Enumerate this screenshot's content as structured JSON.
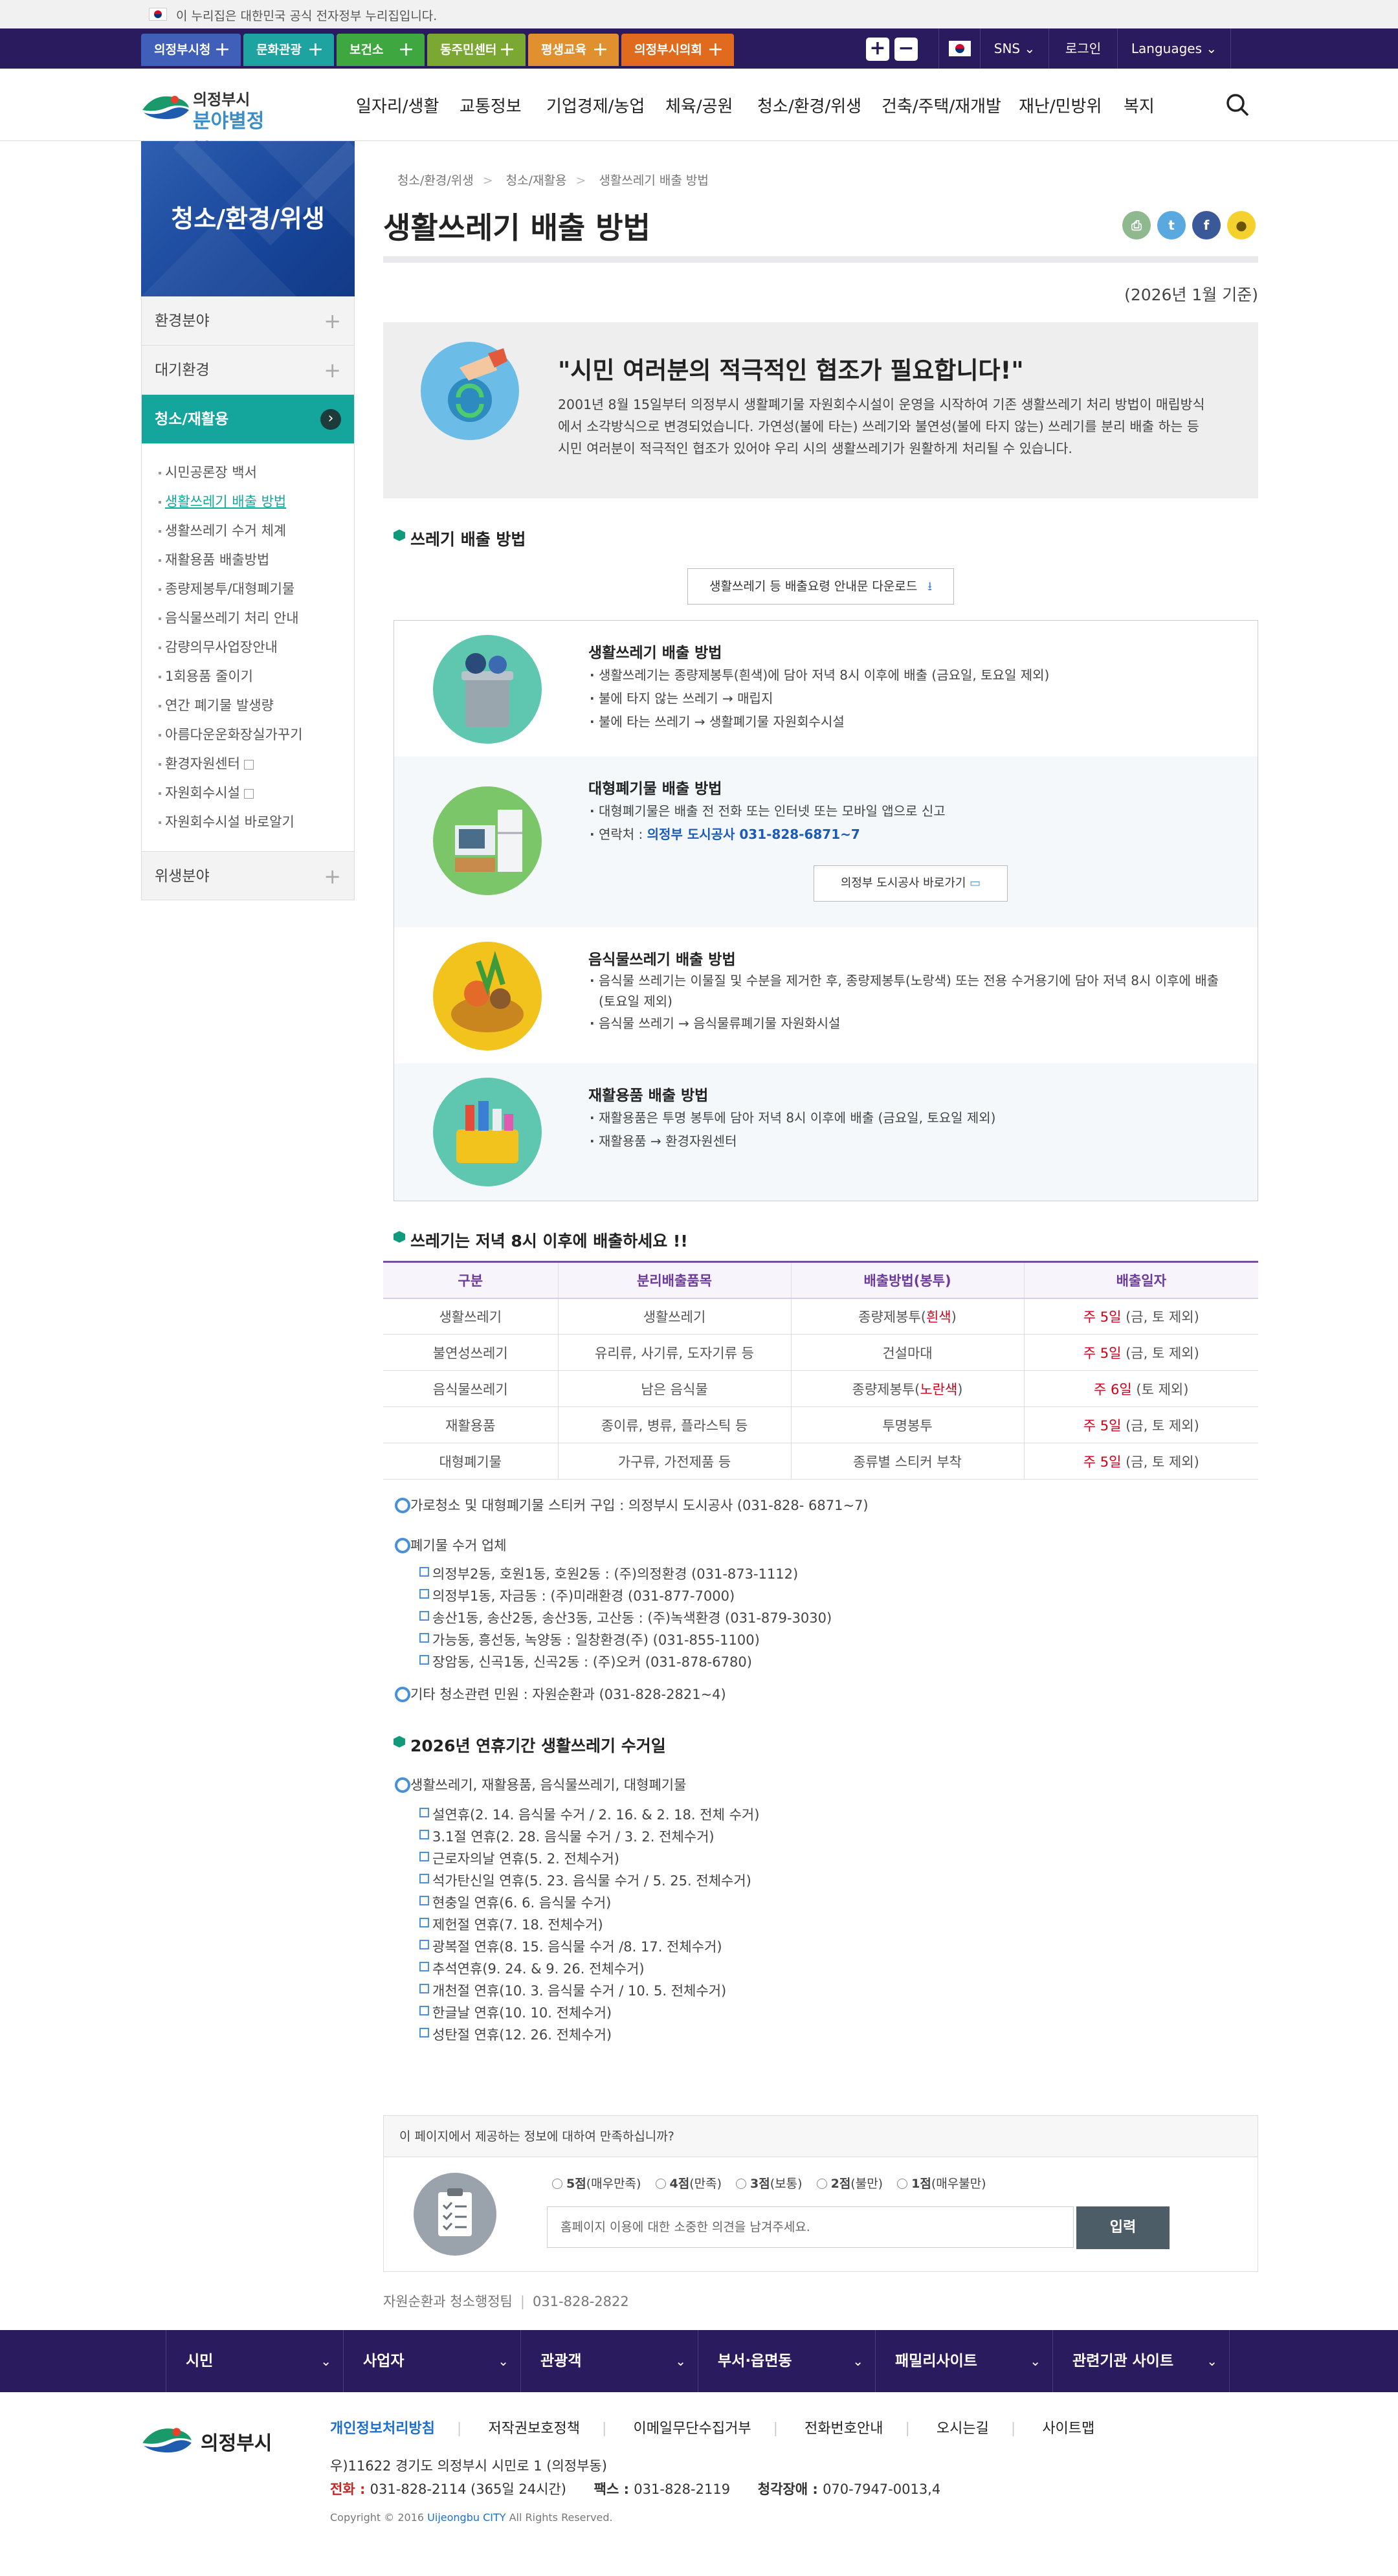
{
  "gov_bar": {
    "text": "이 누리집은 대한민국 공식 전자정부 누리집입니다."
  },
  "top_sites": [
    {
      "label": "의정부시청",
      "color": "#3f5fb8"
    },
    {
      "label": "문화관광",
      "color": "#1fa3a0"
    },
    {
      "label": "보건소",
      "color": "#3fa73f"
    },
    {
      "label": "동주민센터",
      "color": "#7aa832"
    },
    {
      "label": "평생교육",
      "color": "#e0902e"
    },
    {
      "label": "의정부시의회",
      "color": "#e06b1e"
    }
  ],
  "util": {
    "zoom_in": "+",
    "zoom_out": "−",
    "sns": "SNS",
    "login": "로그인",
    "languages": "Languages"
  },
  "logo": {
    "line1": "의정부시",
    "line2": "분야별정보"
  },
  "gnb": [
    "일자리/생활",
    "교통정보",
    "기업경제/농업",
    "체육/공원",
    "청소/환경/위생",
    "건축/주택/재개발",
    "재난/민방위",
    "복지"
  ],
  "lnb": {
    "title": "청소/환경/위생",
    "items": [
      {
        "label": "환경분야"
      },
      {
        "label": "대기환경"
      },
      {
        "label": "청소/재활용"
      }
    ],
    "sub": [
      "시민공론장 백서",
      "생활쓰레기 배출 방법",
      "생활쓰레기 수거 체계",
      "재활용품 배출방법",
      "종량제봉투/대형폐기물",
      "음식물쓰레기 처리 안내",
      "감량의무사업장안내",
      "1회용품 줄이기",
      "연간 폐기물 발생량",
      "아름다운운화장실가꾸기",
      "환경자원센터",
      "자원회수시설",
      "자원회수시설 바로알기"
    ],
    "last": "위생분야"
  },
  "breadcrumb": [
    "청소/환경/위생",
    "청소/재활용",
    "생활쓰레기 배출 방법"
  ],
  "page_title": "생활쓰레기 배출 방법",
  "share": [
    "print",
    "twitter",
    "facebook",
    "kakao"
  ],
  "basis": "(2026년 1월 기준)",
  "intro": {
    "heading": "\"시민 여러분의 적극적인 협조가 필요합니다!\"",
    "body": "2001년 8월 15일부터 의정부시 생활폐기물 자원회수시설이 운영을 시작하여 기존 생활쓰레기 처리 방법이 매립방식에서 소각방식으로 변경되었습니다.  가연성(불에 타는) 쓰레기와 불연성(불에 타지 않는) 쓰레기를 분리 배출 하는 등 시민 여러분이 적극적인 협조가 있어야 우리 시의 생활쓰레기가 원활하게 처리될 수 있습니다."
  },
  "sec1": {
    "title": "쓰레기 배출 방법",
    "download": "생활쓰레기 등 배출요령 안내문 다운로드"
  },
  "disposal": {
    "general": {
      "title": "생활쓰레기 배출 방법",
      "items": [
        "생활쓰레기는 종량제봉투(흰색)에 담아 저녁 8시 이후에 배출 (금요일, 토요일 제외)",
        "불에 타지 않는 쓰레기 → 매립지",
        "불에 타는 쓰레기 → 생활폐기물 자원회수시설"
      ]
    },
    "bulky": {
      "title": "대형폐기물 배출 방법",
      "items": [
        "대형폐기물은 배출 전 전화 또는 인터넷 또는 모바일 앱으로 신고"
      ],
      "contact_label": "연락처 : ",
      "contact_value": "의정부 도시공사 031-828-6871~7",
      "button": "의정부 도시공사 바로가기"
    },
    "food": {
      "title": "음식물쓰레기 배출 방법",
      "items": [
        "음식물 쓰레기는 이물질 및 수분을 제거한 후, 종량제봉투(노랑색) 또는 전용 수거용기에 담아 저녁 8시 이후에 배출 (토요일 제외)",
        "음식물 쓰레기 → 음식물류폐기물 자원화시설"
      ]
    },
    "recycle": {
      "title": "재활용품 배출 방법",
      "items": [
        "재활용품은 투명 봉투에 담아 저녁 8시 이후에 배출 (금요일, 토요일 제외)",
        "재활용품 → 환경자원센터"
      ]
    }
  },
  "sec2": {
    "title": "쓰레기는 저녁 8시 이후에 배출하세요 !!"
  },
  "table": {
    "headers": [
      "구분",
      "분리배출품목",
      "배출방법(봉투)",
      "배출일자"
    ],
    "rows": [
      {
        "kind": "생활쓰레기",
        "items": "생활쓰레기",
        "bag": "종량제봉투(",
        "bag_color": "흰색",
        "bag_end": ")",
        "days": "주 5일",
        "days_note": " (금, 토 제외)"
      },
      {
        "kind": "불연성쓰레기",
        "items": "유리류, 사기류, 도자기류 등",
        "bag": "건설마대",
        "bag_color": "",
        "bag_end": "",
        "days": "주 5일",
        "days_note": " (금, 토 제외)"
      },
      {
        "kind": "음식물쓰레기",
        "items": "남은 음식물",
        "bag": "종량제봉투(",
        "bag_color": "노란색",
        "bag_end": ")",
        "days": "주 6일",
        "days_note": "  (토 제외)"
      },
      {
        "kind": "재활용품",
        "items": "종이류, 병류, 플라스틱 등",
        "bag": "투명봉투",
        "bag_color": "",
        "bag_end": "",
        "days": "주 5일",
        "days_note": " (금, 토 제외)"
      },
      {
        "kind": "대형폐기물",
        "items": "가구류, 가전제품 등",
        "bag": "종류별 스티커 부착",
        "bag_color": "",
        "bag_end": "",
        "days": "주 5일",
        "days_note": " (금, 토 제외)"
      }
    ]
  },
  "notes": {
    "sticker": "가로청소 및 대형폐기물 스티커 구입 : 의정부시 도시공사 (031-828- 6871~7)",
    "collectors_title": "폐기물 수거 업체",
    "collectors": [
      "의정부2동, 호원1동, 호원2동 : (주)의정환경 (031-873-1112)",
      "의정부1동, 자금동 : (주)미래환경 (031-877-7000)",
      "송산1동, 송산2동, 송산3동, 고산동 : (주)녹색환경 (031-879-3030)",
      "가능동, 흥선동, 녹양동 : 일창환경(주) (031-855-1100)",
      "장암동, 신곡1동, 신곡2동 : (주)오커 (031-878-6780)"
    ],
    "other": "기타 청소관련 민원 : 자원순환과 (031-828-2821~4)"
  },
  "sec3": {
    "title": "2026년 연휴기간 생활쓰레기 수거일",
    "subtitle": "생활쓰레기, 재활용품, 음식물쓰레기, 대형폐기물",
    "items": [
      "설연휴(2. 14. 음식물 수거 / 2. 16. & 2. 18. 전체 수거)",
      "3.1절 연휴(2. 28. 음식물 수거 / 3. 2. 전체수거)",
      "근로자의날 연휴(5. 2. 전체수거)",
      "석가탄신일 연휴(5. 23. 음식물 수거 / 5. 25. 전체수거)",
      "현충일 연휴(6. 6. 음식물 수거)",
      "제헌절 연휴(7. 18. 전체수거)",
      "광복절 연휴(8. 15. 음식물 수거 /8. 17. 전체수거)",
      "추석연휴(9. 24. & 9. 26. 전체수거)",
      "개천절 연휴(10. 3. 음식물 수거 / 10. 5. 전체수거)",
      "한글날 연휴(10. 10. 전체수거)",
      "성탄절 연휴(12. 26. 전체수거)"
    ]
  },
  "survey": {
    "question": "이 페이지에서 제공하는 정보에 대하여 만족하십니까?",
    "options": [
      {
        "score": "5점",
        "desc": "(매우만족)"
      },
      {
        "score": "4점",
        "desc": "(만족)"
      },
      {
        "score": "3점",
        "desc": "(보통)"
      },
      {
        "score": "2점",
        "desc": "(불만)"
      },
      {
        "score": "1점",
        "desc": "(매우불만)"
      }
    ],
    "placeholder": "홈페이지 이용에 대한 소중한 의견을 남겨주세요.",
    "submit": "입력"
  },
  "contact": {
    "dept": "자원순환과 청소행정팀",
    "phone": "031-828-2822"
  },
  "footer_nav": [
    "시민",
    "사업자",
    "관광객",
    "부서·읍면동",
    "패밀리사이트",
    "관련기관 사이트"
  ],
  "footer": {
    "logo": "의정부시",
    "links": [
      "개인정보처리방침",
      "저작권보호정책",
      "이메일무단수집거부",
      "전화번호안내",
      "오시는길",
      "사이트맵"
    ],
    "address": "우)11622 경기도 의정부시 시민로 1 (의정부동)",
    "phone_label": "전화 : ",
    "phone": "031-828-2114 (365일 24시간)",
    "fax_label": "팩스 : ",
    "fax": "031-828-2119",
    "deaf_label": "청각장애 : ",
    "deaf": "070-7947-0013,4",
    "copy_pre": "Copyright © 2016 ",
    "copy_city": "Uijeongbu CITY",
    "copy_post": " All Rights Reserved."
  }
}
